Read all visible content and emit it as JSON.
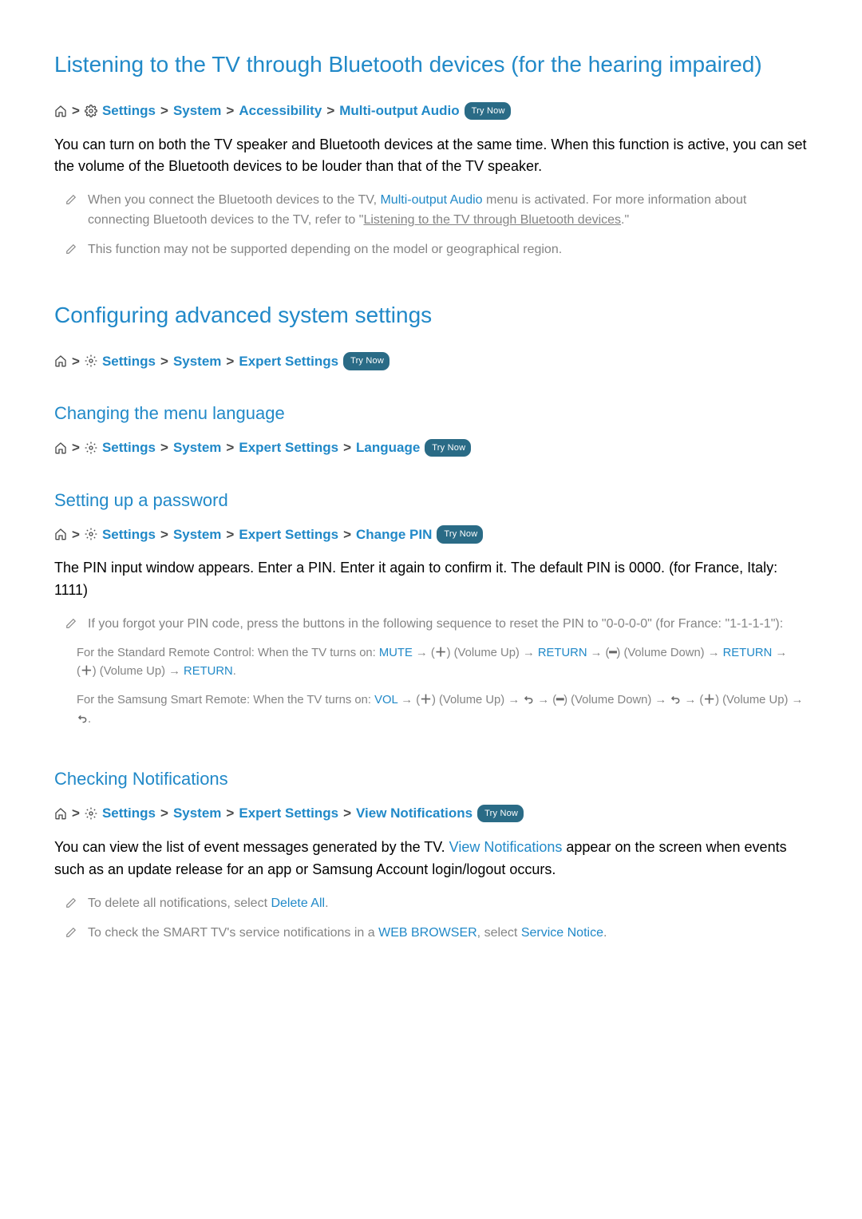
{
  "s1": {
    "title": "Listening to the TV through Bluetooth devices (for the hearing impaired)",
    "bc": {
      "b1": "Settings",
      "b2": "System",
      "b3": "Accessibility",
      "b4": "Multi-output Audio",
      "try": "Try Now"
    },
    "para": "You can turn on both the TV speaker and Bluetooth devices at the same time. When this function is active, you can set the volume of the Bluetooth devices to be louder than that of the TV speaker.",
    "note1a": "When you connect the Bluetooth devices to the TV, ",
    "note1b": "Multi-output Audio",
    "note1c": " menu is activated. For more information about connecting Bluetooth devices to the TV, refer to \"",
    "note1d": "Listening to the TV through Bluetooth devices",
    "note1e": ".\"",
    "note2": "This function may not be supported depending on the model or geographical region."
  },
  "s2": {
    "title": "Configuring advanced system settings",
    "bc": {
      "b1": "Settings",
      "b2": "System",
      "b3": "Expert Settings",
      "try": "Try Now"
    }
  },
  "s3": {
    "title": "Changing the menu language",
    "bc": {
      "b1": "Settings",
      "b2": "System",
      "b3": "Expert Settings",
      "b4": "Language",
      "try": "Try Now"
    }
  },
  "s4": {
    "title": "Setting up a password",
    "bc": {
      "b1": "Settings",
      "b2": "System",
      "b3": "Expert Settings",
      "b4": "Change PIN",
      "try": "Try Now"
    },
    "para": "The PIN input window appears. Enter a PIN. Enter it again to confirm it. The default PIN is 0000. (for France, Italy: 1111)",
    "note1": "If you forgot your PIN code, press the buttons in the following sequence to reset the PIN to \"0-0-0-0\" (for France: \"1-1-1-1\"):",
    "std_a": "For the Standard Remote Control: When the TV turns on: ",
    "std_mute": "MUTE",
    "std_b": " → (",
    "std_plus": "＋",
    "std_c": ") (Volume Up) → ",
    "std_return": "RETURN",
    "std_d": " → (",
    "std_minus": "━",
    "std_e": ") (Volume Down) → ",
    "std_f": " → (",
    "std_g": ") (Volume Up) → ",
    "std_h": ".",
    "smart_a": "For the Samsung Smart Remote: When the TV turns on: ",
    "smart_vol": "VOL",
    "smart_b": " → (",
    "smart_c": ") (Volume Up) → ",
    "smart_d": " → (",
    "smart_e": ") (Volume Down) → ",
    "smart_f": " → (",
    "smart_g": ") (Volume Up) → ",
    "smart_h": "."
  },
  "s5": {
    "title": "Checking Notifications",
    "bc": {
      "b1": "Settings",
      "b2": "System",
      "b3": "Expert Settings",
      "b4": "View Notifications",
      "try": "Try Now"
    },
    "para_a": "You can view the list of event messages generated by the TV. ",
    "para_b": "View Notifications",
    "para_c": " appear on the screen when events such as an update release for an app or Samsung Account login/logout occurs.",
    "note1a": "To delete all notifications, select ",
    "note1b": "Delete All",
    "note1c": ".",
    "note2a": "To check the SMART TV's service notifications in a ",
    "note2b": "WEB BROWSER",
    "note2c": ", select ",
    "note2d": "Service Notice",
    "note2e": "."
  }
}
